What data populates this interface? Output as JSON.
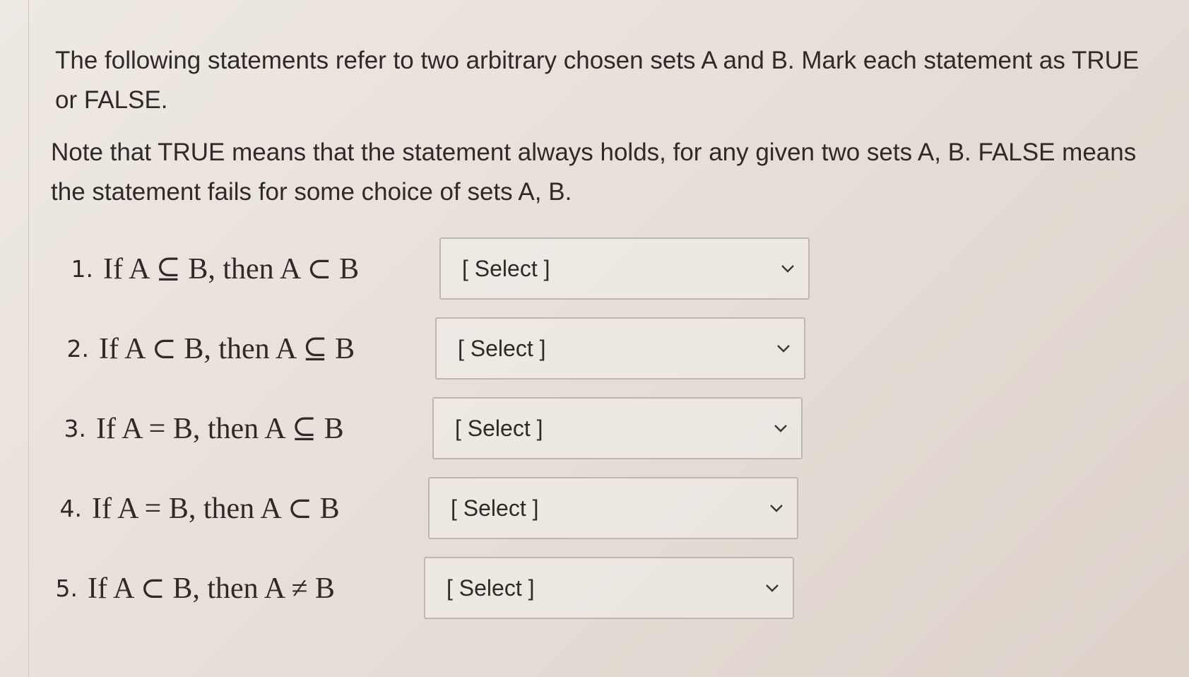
{
  "prompt": {
    "intro": "The following statements refer to two arbitrary chosen sets A and B.  Mark each statement as TRUE or FALSE.",
    "note": "Note that TRUE means that the statement always holds, for any given two sets A, B. FALSE means the statement fails for some choice of sets A, B."
  },
  "questions": [
    {
      "number": "1.",
      "statement": "If A ⊆ B, then A ⊂ B",
      "selected": "[ Select ]"
    },
    {
      "number": "2.",
      "statement": "If A ⊂ B, then A ⊆ B",
      "selected": "[ Select ]"
    },
    {
      "number": "3.",
      "statement": "If A = B, then A ⊆ B",
      "selected": "[ Select ]"
    },
    {
      "number": "4.",
      "statement": "If A = B, then A ⊂ B",
      "selected": "[ Select ]"
    },
    {
      "number": "5.",
      "statement": "If A ⊂ B, then A ≠ B",
      "selected": "[ Select ]"
    }
  ],
  "icons": {
    "dropdown": "chevron-down-icon"
  }
}
